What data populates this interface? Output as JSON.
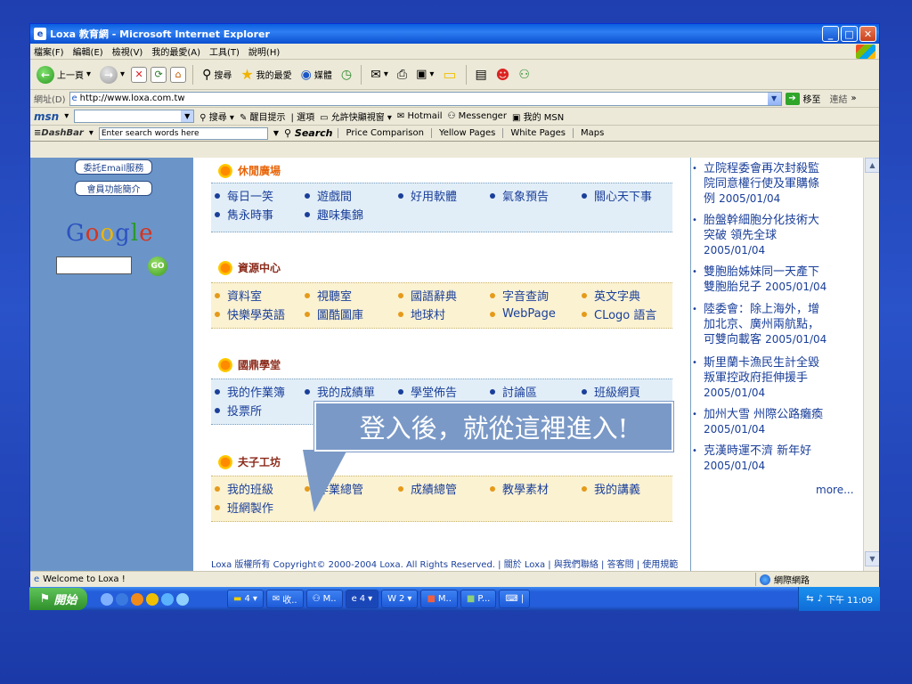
{
  "window": {
    "title": "Loxa 教育網 - Microsoft Internet Explorer"
  },
  "menu": [
    "檔案(F)",
    "編輯(E)",
    "檢視(V)",
    "我的最愛(A)",
    "工具(T)",
    "說明(H)"
  ],
  "toolbar": {
    "back": "上一頁",
    "search": "搜尋",
    "favorites": "我的最愛",
    "media": "媒體"
  },
  "address": {
    "label": "網址(D)",
    "url": "http://www.loxa.com.tw",
    "go": "移至",
    "links": "連結"
  },
  "msn": {
    "logo": "msn",
    "search": "搜尋",
    "highlight": "醒目提示",
    "options": "選項",
    "popup": "允許快顯視窗",
    "hotmail": "Hotmail",
    "messenger": "Messenger",
    "mymsn": "我的 MSN"
  },
  "dashbar": {
    "logo": "DashBar",
    "placeholder": "Enter search words here",
    "search": "Search",
    "links": [
      "Price Comparison",
      "Yellow Pages",
      "White Pages",
      "Maps"
    ]
  },
  "left": {
    "btn1": "委託Email服務",
    "btn2": "會員功能簡介",
    "google": "Google",
    "go": "GO"
  },
  "sections": [
    {
      "title": "休閒廣場",
      "rows": [
        [
          "每日一笑",
          "遊戲間",
          "好用軟體",
          "氣象預告",
          "關心天下事"
        ],
        [
          "雋永時事",
          "趣味集錦"
        ]
      ]
    },
    {
      "title": "資源中心",
      "rows": [
        [
          "資料室",
          "視聽室",
          "國語辭典",
          "字音查詢",
          "英文字典"
        ],
        [
          "快樂學英語",
          "圖酷圖庫",
          "地球村",
          "WebPage",
          "CLogo 語言"
        ]
      ]
    },
    {
      "title": "國鼎學堂",
      "rows": [
        [
          "我的作業簿",
          "我的成績單",
          "學堂佈告",
          "討論區",
          "班級網頁"
        ],
        [
          "投票所"
        ]
      ]
    },
    {
      "title": "夫子工坊",
      "rows": [
        [
          "我的班級",
          "作業總管",
          "成績總管",
          "教學素材",
          "我的講義"
        ],
        [
          "班網製作"
        ]
      ]
    }
  ],
  "news": [
    {
      "lines": [
        "立院程委會再次封殺監",
        "院同意權行使及軍購條"
      ],
      "tail": "例",
      "date": "2005/01/04"
    },
    {
      "lines": [
        "胎盤幹細胞分化技術大",
        "突破 領先全球"
      ],
      "tail": "",
      "date": "2005/01/04"
    },
    {
      "lines": [
        "雙胞胎姊妹同一天產下"
      ],
      "tail": "雙胞胎兒子",
      "date": "2005/01/04"
    },
    {
      "lines": [
        "陸委會：除上海外，增",
        "加北京、廣州兩航點，"
      ],
      "tail": "可雙向載客",
      "date": "2005/01/04"
    },
    {
      "lines": [
        "斯里蘭卡漁民生計全毀",
        "叛軍控政府拒伸援手"
      ],
      "tail": "",
      "date": "2005/01/04"
    },
    {
      "lines": [
        "加州大雪 州際公路癱瘓"
      ],
      "tail": "",
      "date": "2005/01/04"
    },
    {
      "lines": [
        "克漢時運不濟 新年好"
      ],
      "tail": "",
      "date": "2005/01/04"
    }
  ],
  "more": "more...",
  "callout": "登入後，就從這裡進入!",
  "footer": "Loxa 版權所有 Copyright© 2000-2004 Loxa. All Rights Reserved. | 關於 Loxa | 與我們聯絡 | 答客問 | 使用規範",
  "status": {
    "text": "Welcome to Loxa !",
    "zone": "網際網路"
  },
  "taskbar": {
    "start": "開始",
    "items": [
      "4",
      "收..",
      "M..",
      "4",
      "2",
      "M..",
      "P..."
    ],
    "clock": "下午 11:09"
  }
}
